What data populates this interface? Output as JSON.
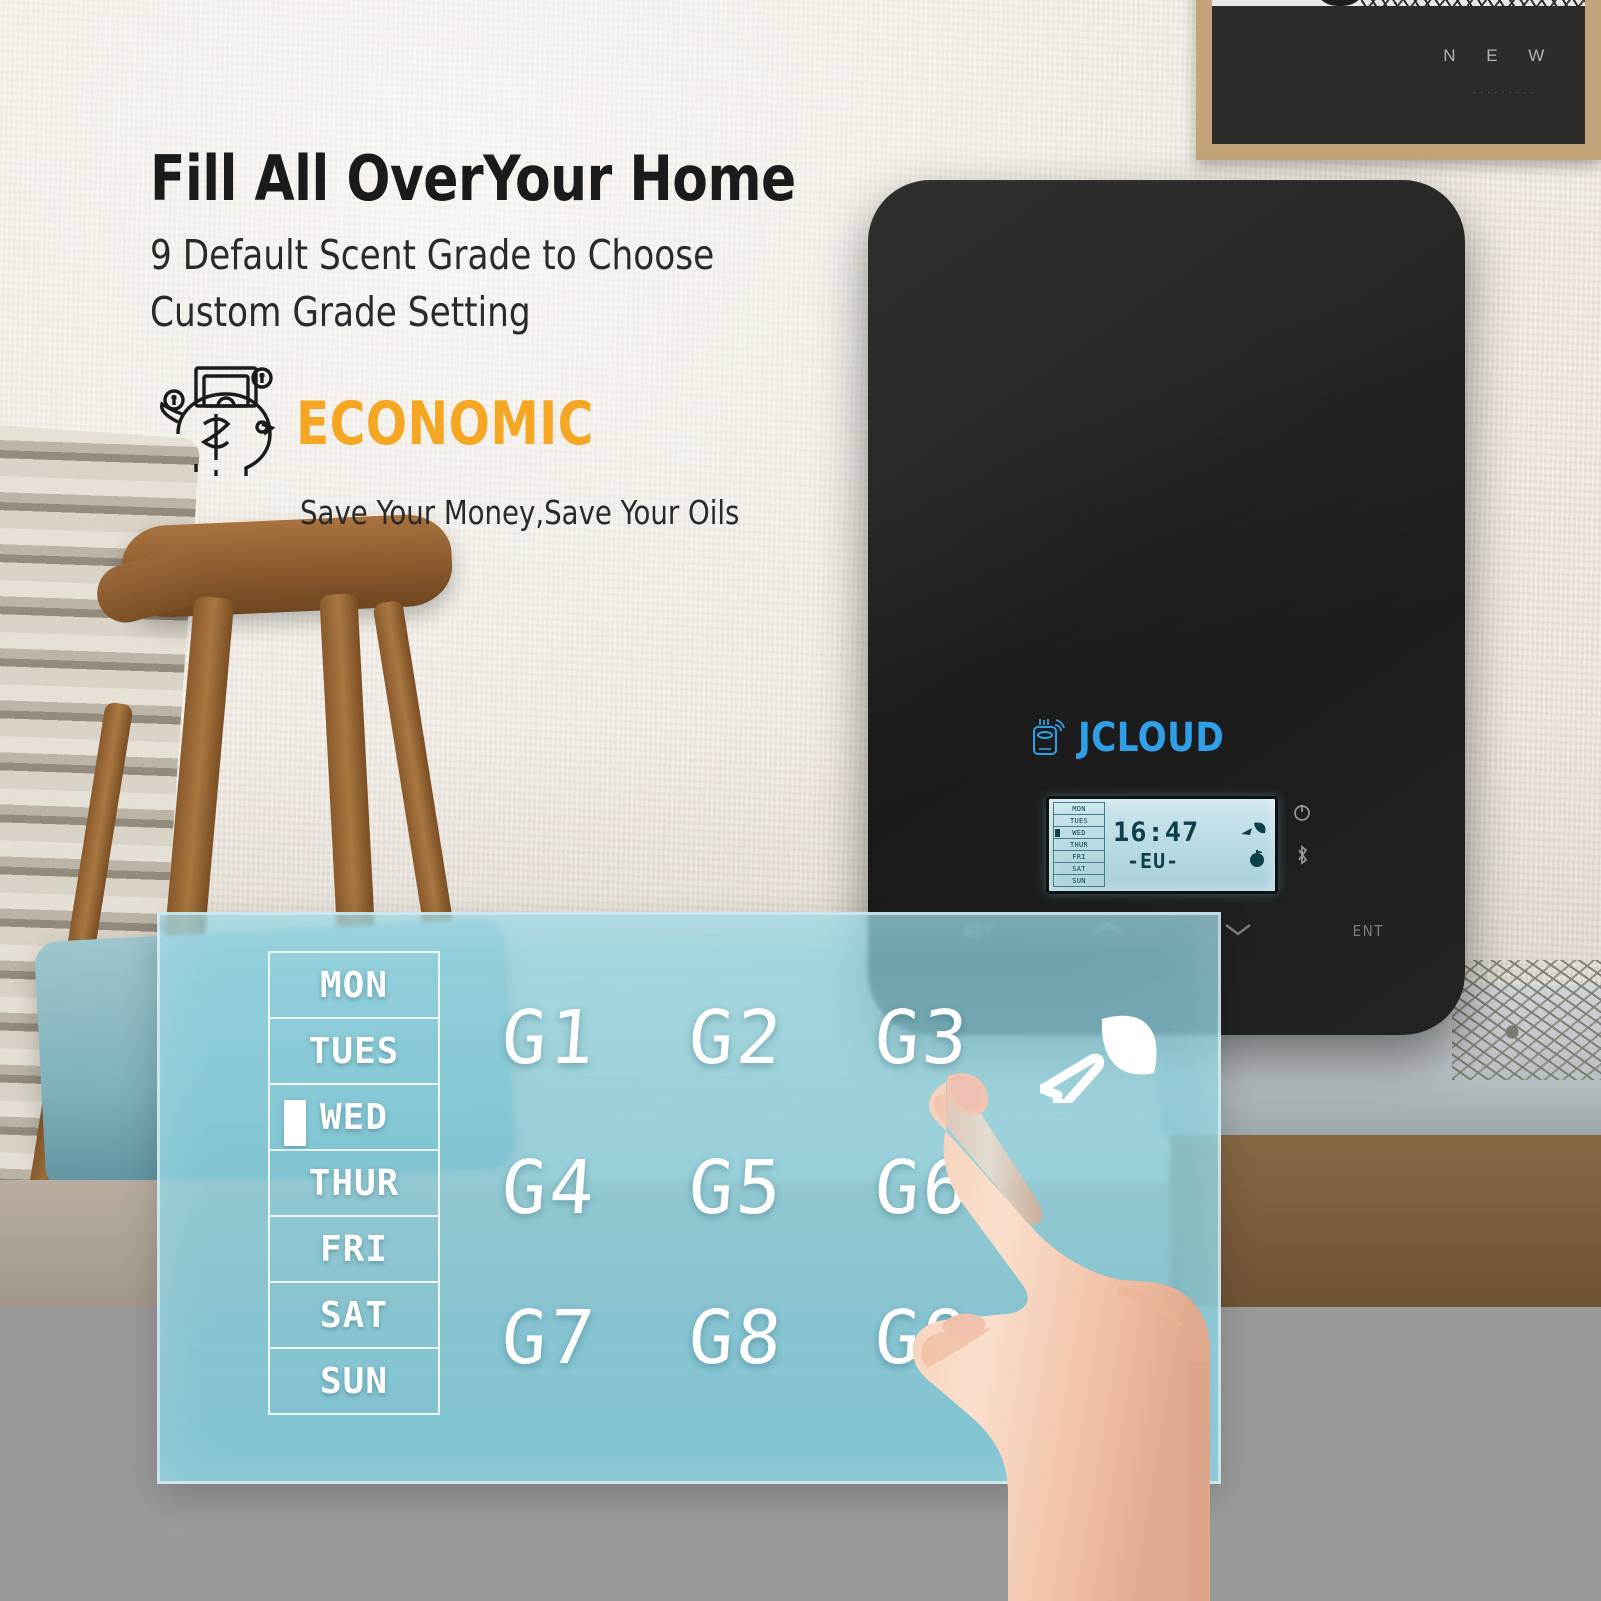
{
  "headline": {
    "title": "Fill All OverYour Home",
    "sub1": "9 Default Scent Grade to Choose",
    "sub2": "Custom Grade Setting",
    "badge": "ECONOMIC",
    "tagline": "Save Your Money,Save Your Oils",
    "badge_color": "#F5A623",
    "piggy_icon": "piggy-bank-icon"
  },
  "device": {
    "brand": "JCLOUD",
    "brand_color": "#2FA0E8",
    "brand_icon": "diffuser-wifi-icon",
    "lcd": {
      "days": [
        {
          "label": "MON",
          "active": false
        },
        {
          "label": "TUES",
          "active": false
        },
        {
          "label": "WED",
          "active": true
        },
        {
          "label": "THUR",
          "active": false
        },
        {
          "label": "FRI",
          "active": false
        },
        {
          "label": "SAT",
          "active": false
        },
        {
          "label": "SUN",
          "active": false
        }
      ],
      "time": "16:47",
      "mode": "-EU-",
      "spray_icon": "spray-nozzle-icon",
      "bottle_icon": "oil-bottle-icon"
    },
    "indicators": [
      {
        "name": "power-icon"
      },
      {
        "name": "bluetooth-icon"
      }
    ],
    "buttons": [
      {
        "label": "SET",
        "icon": "none"
      },
      {
        "label": "",
        "icon": "chevron-up-icon"
      },
      {
        "label": "",
        "icon": "chevron-down-icon"
      },
      {
        "label": "ENT",
        "icon": "none"
      }
    ]
  },
  "overlay": {
    "days": [
      {
        "label": "MON",
        "active": false
      },
      {
        "label": "TUES",
        "active": false
      },
      {
        "label": "WED",
        "active": true
      },
      {
        "label": "THUR",
        "active": false
      },
      {
        "label": "FRI",
        "active": false
      },
      {
        "label": "SAT",
        "active": false
      },
      {
        "label": "SUN",
        "active": false
      }
    ],
    "grades": [
      "G1",
      "G2",
      "G3",
      "G4",
      "G5",
      "G6",
      "G7",
      "G8",
      "G9"
    ],
    "spray_icon": "spray-nozzle-icon",
    "hand_icon": "pointing-hand"
  },
  "background": {
    "poster_word": "N E W",
    "poster_sub": "........."
  }
}
